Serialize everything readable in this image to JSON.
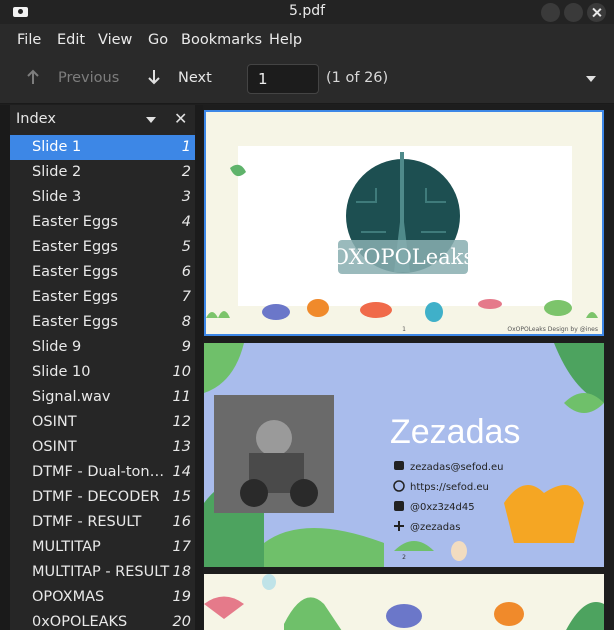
{
  "window": {
    "title": "5.pdf"
  },
  "menu": [
    "File",
    "Edit",
    "View",
    "Go",
    "Bookmarks",
    "Help"
  ],
  "toolbar": {
    "previous_label": "Previous",
    "next_label": "Next",
    "page_value": "1",
    "page_count": "(1 of 26)"
  },
  "sidebar": {
    "title": "Index",
    "items": [
      {
        "label": "Slide 1",
        "page": "1"
      },
      {
        "label": "Slide 2",
        "page": "2"
      },
      {
        "label": "Slide 3",
        "page": "3"
      },
      {
        "label": "Easter Eggs",
        "page": "4"
      },
      {
        "label": "Easter Eggs",
        "page": "5"
      },
      {
        "label": "Easter Eggs",
        "page": "6"
      },
      {
        "label": "Easter Eggs",
        "page": "7"
      },
      {
        "label": "Easter Eggs",
        "page": "8"
      },
      {
        "label": "Slide 9",
        "page": "9"
      },
      {
        "label": "Slide 10",
        "page": "10"
      },
      {
        "label": "Signal.wav",
        "page": "11"
      },
      {
        "label": "OSINT",
        "page": "12"
      },
      {
        "label": "OSINT",
        "page": "13"
      },
      {
        "label": "DTMF - Dual-tone multi-frequency",
        "page": "14"
      },
      {
        "label": "DTMF - DECODER",
        "page": "15"
      },
      {
        "label": "DTMF - RESULT",
        "page": "16"
      },
      {
        "label": "MULTITAP",
        "page": "17"
      },
      {
        "label": "MULTITAP - RESULT",
        "page": "18"
      },
      {
        "label": "OPOXMAS",
        "page": "19"
      },
      {
        "label": "0xOPOLEAKS",
        "page": "20"
      }
    ],
    "selected_index": 0
  },
  "slides": {
    "slide1": {
      "logo_text": "OXOPOLeaks",
      "page_number": "1",
      "credit": "OxOPOLeaks Design by @ines"
    },
    "slide2": {
      "name": "Zezadas",
      "contacts": [
        {
          "icon": "mail-icon",
          "text": "zezadas@sefod.eu"
        },
        {
          "icon": "globe-icon",
          "text": "https://sefod.eu"
        },
        {
          "icon": "twitter-icon",
          "text": "@0xz3z4d45"
        },
        {
          "icon": "slack-icon",
          "text": "@zezadas"
        }
      ],
      "page_number": "2"
    }
  },
  "colors": {
    "selection": "#3d87e6",
    "slide_bg": "#f6f5e6",
    "slide2_bg": "#a9bcec",
    "logo_circle": "#1d4f51"
  }
}
